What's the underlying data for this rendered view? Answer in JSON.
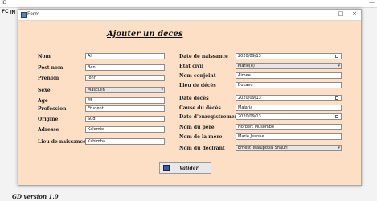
{
  "background": {
    "title": "ID",
    "minimize_glyph": "—",
    "menu_label": "FC",
    "menu_item": "IN",
    "version": "GD version 1.0"
  },
  "window": {
    "title": "Form",
    "minimize": "—",
    "maximize": "□",
    "close": "×"
  },
  "heading": "Ajouter un deces",
  "left_fields": [
    {
      "label": "Nom",
      "value": "Ali"
    },
    {
      "label": "Post nom",
      "value": "Ben"
    },
    {
      "label": "Prenom",
      "value": "John"
    },
    {
      "label": "Sexe",
      "value": "Masculin",
      "type": "select"
    },
    {
      "label": "Age",
      "value": "45"
    },
    {
      "label": "Profession",
      "value": "Etudent"
    },
    {
      "label": "Origine",
      "value": "Sud"
    },
    {
      "label": "Adresse",
      "value": "Kalemie"
    },
    {
      "label": "Lieu de naissance",
      "value": "Kabimba"
    }
  ],
  "right_fields": [
    {
      "label": "Date de naissance",
      "value": "2020/09/13",
      "type": "date"
    },
    {
      "label": "Etat civil",
      "value": "Marié(e)",
      "type": "select"
    },
    {
      "label": "Nom conjoint",
      "value": "Aimee"
    },
    {
      "label": "Lieu de décès",
      "value": "Bukavu"
    },
    {
      "label": "Date décès",
      "value": "2020/09/13",
      "type": "date"
    },
    {
      "label": "Cause du décès",
      "value": "Malaria"
    },
    {
      "label": "Date d'enregistrement",
      "value": "2020/09/13",
      "type": "date"
    },
    {
      "label": "Nom du père",
      "value": "Norbert Musombo"
    },
    {
      "label": "Nom de la mère",
      "value": "Marie Jeanne"
    },
    {
      "label": "Nom du declrant",
      "value": "Ernest_Walupopa_Shauri",
      "type": "select"
    }
  ],
  "submit_label": "Valider"
}
